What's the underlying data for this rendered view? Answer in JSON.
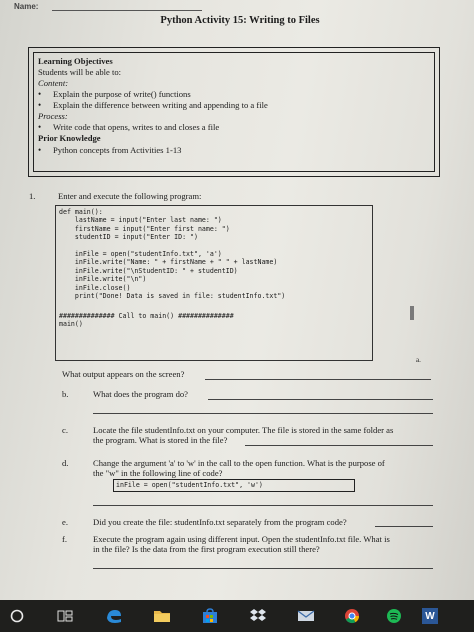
{
  "header": {
    "name_label": "Name:",
    "title": "Python Activity 15: Writing to Files"
  },
  "objectives": {
    "heading": "Learning Objectives",
    "intro": "Students will be able to:",
    "content_label": "Content:",
    "content_items": [
      "Explain the purpose of write() functions",
      "Explain the difference between writing and appending to a file"
    ],
    "process_label": "Process:",
    "process_items": [
      "Write code that opens, writes to and closes a file"
    ],
    "prior_label": "Prior Knowledge",
    "prior_items": [
      "Python concepts from Activities 1-13"
    ]
  },
  "q1": {
    "number": "1.",
    "prompt": "Enter and execute the following program:",
    "code_lines": [
      "def main():",
      "    lastName = input(\"Enter last name: \")",
      "    firstName = input(\"Enter first name: \")",
      "    studentID = input(\"Enter ID: \")",
      "",
      "    inFile = open(\"studentInfo.txt\", 'a')",
      "    inFile.write(\"Name: \" + firstName + \" \" + lastName)",
      "    inFile.write(\"\\nStudentID: \" + studentID)",
      "    inFile.write(\"\\n\")",
      "    inFile.close()",
      "    print(\"Done! Data is saved in file: studentInfo.txt\")",
      "",
      "############## Call to main() ##############",
      "main()"
    ],
    "a_marker": "a.",
    "a_question": "What output appears on the screen?",
    "b_marker": "b.",
    "b_question": "What does the program do?",
    "c_marker": "c.",
    "c_question_line1": "Locate the file studentInfo.txt on your computer. The file is stored in the same folder as",
    "c_question_line2": "the program. What is stored in the file?",
    "d_marker": "d.",
    "d_question_line1": "Change the argument 'a' to 'w' in the call to the open function. What is the purpose of",
    "d_question_line2": "the \"w\" in the following line of code?",
    "d_code": "inFile = open(\"studentInfo.txt\", 'w')",
    "e_marker": "e.",
    "e_question": "Did you create the file: studentInfo.txt separately from the program code?",
    "f_marker": "f.",
    "f_question_line1": "Execute the program again using different input. Open the studentInfo.txt file. What is",
    "f_question_line2": "in the file? Is the data from the first program execution still there?"
  },
  "taskbar": {
    "icons": [
      "start-circle-icon",
      "task-view-icon",
      "edge-icon",
      "file-explorer-icon",
      "store-icon",
      "dropbox-icon",
      "mail-icon",
      "chrome-icon",
      "spotify-icon",
      "word-icon"
    ],
    "word_letter": "W"
  }
}
